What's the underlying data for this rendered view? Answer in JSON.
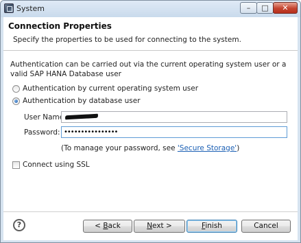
{
  "window": {
    "title": "System"
  },
  "header": {
    "title": "Connection Properties",
    "description": "Specify the properties to be used for connecting to the system."
  },
  "content": {
    "info_text": "Authentication can be carried out via the current operating system user or a valid SAP HANA Database user",
    "auth_options": [
      {
        "label": "Authentication by current operating system user",
        "selected": false
      },
      {
        "label": "Authentication by database user",
        "selected": true
      }
    ],
    "user_name_label": "User Name:",
    "user_name_value": "",
    "password_label": "Password:",
    "password_value": "••••••••••••••••",
    "manage_prefix": "(To manage your password, see ",
    "manage_link": "'Secure Storage'",
    "manage_suffix": ")",
    "ssl_label": "Connect using SSL",
    "ssl_checked": false
  },
  "footer": {
    "help_icon": "?",
    "back_pre": "< ",
    "back_mnemonic": "B",
    "back_post": "ack",
    "next_mnemonic": "N",
    "next_post": "ext >",
    "finish_mnemonic": "F",
    "finish_post": "inish",
    "cancel_label": "Cancel"
  },
  "icons": {
    "app": "system-app-icon",
    "minimize": "minimize-icon",
    "maximize": "maximize-icon",
    "close": "close-icon",
    "help": "help-icon"
  },
  "colors": {
    "window_frame": "#d6e3f0",
    "close_button": "#c4432f",
    "link": "#1a5fb4",
    "focus_border": "#5d9bd6"
  }
}
